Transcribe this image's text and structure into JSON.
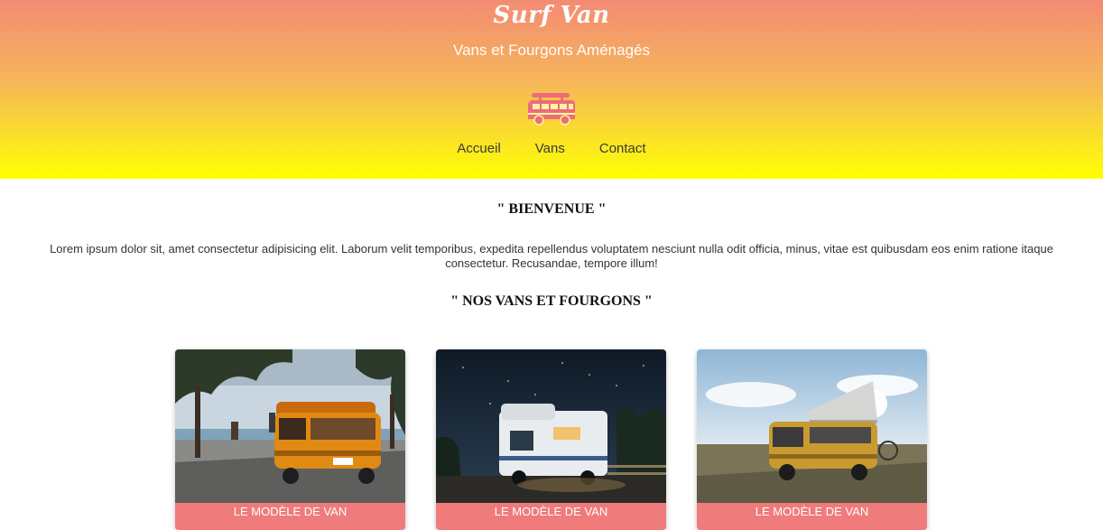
{
  "header": {
    "brand": "Surf Van",
    "tagline": "Vans et Fourgons Aménagés",
    "logo_icon": "van-icon",
    "logo_color": "#f06b7c",
    "gradient": [
      "#f38b74",
      "#ffff00"
    ]
  },
  "nav": {
    "items": [
      {
        "label": "Accueil"
      },
      {
        "label": "Vans"
      },
      {
        "label": "Contact"
      }
    ]
  },
  "main": {
    "welcome_title": "\" BIENVENUE \"",
    "intro": "Lorem ipsum dolor sit, amet consectetur adipisicing elit. Laborum velit temporibus, expedita repellendus voluptatem nesciunt nulla odit officia, minus, vitae est quibusdam eos enim ratione itaque consectetur. Recusandae, tempore illum!",
    "vans_title": "\" NOS VANS ET FOURGONS \""
  },
  "cards": [
    {
      "label": "LE MODÈLE DE VAN",
      "photo": "orange-van-beach-photo"
    },
    {
      "label": "LE MODÈLE DE VAN",
      "photo": "camper-night-photo"
    },
    {
      "label": "LE MODÈLE DE VAN",
      "photo": "yellow-van-poptop-photo"
    }
  ],
  "colors": {
    "card_label_bg": "#f07b7b",
    "nav_text": "#3a3a3a"
  }
}
